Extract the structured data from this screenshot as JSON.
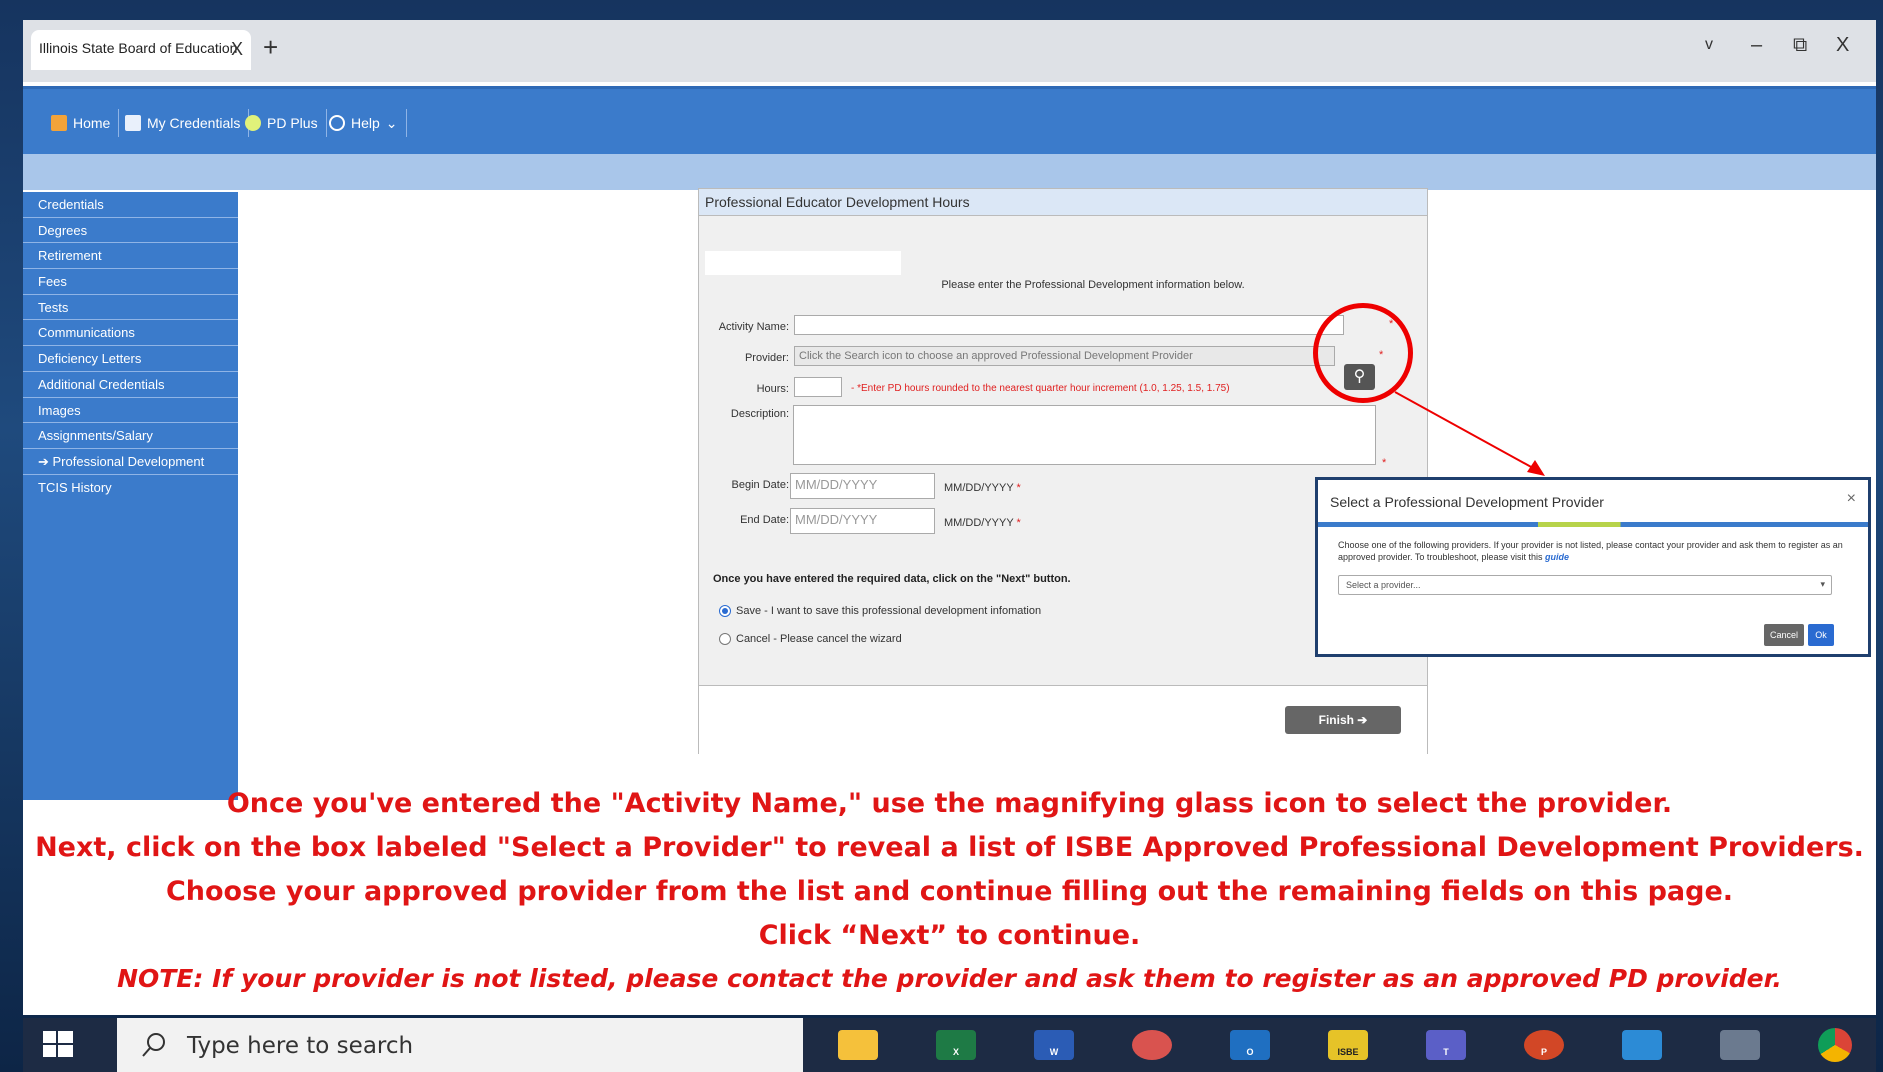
{
  "browser": {
    "tab_title": "Illinois State Board of Education",
    "tab_close": "X",
    "new_tab": "+",
    "controls": {
      "chevron": "v",
      "minimize": "–",
      "restore": "⧉",
      "close": "X"
    }
  },
  "topnav": [
    {
      "label": "Home",
      "icon": "home-icon",
      "color": "#f2a33a"
    },
    {
      "label": "My Credentials",
      "icon": "credentials-icon",
      "color": "#e9f0fb"
    },
    {
      "label": "PD Plus",
      "icon": "sparkle-icon",
      "color": "#e0f27a"
    },
    {
      "label": "Help",
      "icon": "help-icon",
      "color": "#ffffff"
    }
  ],
  "help_chevron": "⌄",
  "sidebar": [
    "Credentials",
    "Degrees",
    "Retirement",
    "Fees",
    "Tests",
    "Communications",
    "Deficiency Letters",
    "Additional Credentials",
    "Images",
    "Assignments/Salary",
    "➔ Professional Development",
    "TCIS History"
  ],
  "form": {
    "title": "Professional Educator Development Hours",
    "intro": "Please enter the Professional Development information below.",
    "activity_label": "Activity Name:",
    "provider_label": "Provider:",
    "provider_placeholder": "Click the Search icon to choose an approved Professional Development Provider",
    "hours_label": "Hours:",
    "hours_hint": "- *Enter PD hours rounded to the nearest quarter hour increment (1.0, 1.25, 1.5, 1.75)",
    "description_label": "Description:",
    "begin_label": "Begin Date:",
    "end_label": "End Date:",
    "date_placeholder": "MM/DD/YYYY",
    "date_format": "MM/DD/YYYY",
    "required": "*",
    "next_text": "Once you have entered the required data, click on the \"Next\" button.",
    "save_option": "Save - I want to save this professional development infomation",
    "cancel_option": "Cancel - Please cancel the wizard",
    "finish_label": "Finish ➔"
  },
  "modal": {
    "title": "Select a Professional Development Provider",
    "close": "×",
    "text": "Choose one of the following providers. If your provider is not listed, please contact your provider and ask them to register as an approved provider. To troubleshoot, please visit this",
    "link": "guide",
    "select_placeholder": "Select a provider...",
    "cancel": "Cancel",
    "ok": "Ok"
  },
  "captions": [
    "Once you've entered the \"Activity Name,\" use the magnifying glass icon to select the provider.",
    "Next, click on the box labeled \"Select a Provider\" to reveal a list of ISBE Approved Professional Development Providers.",
    "Choose your approved provider from the list and continue filling out the remaining fields on this page.",
    "Click “Next” to continue."
  ],
  "note": "NOTE: If your provider is not listed, please contact the provider and ask them to register as an approved PD provider.",
  "taskbar": {
    "search_placeholder": "Type here to search",
    "apps": [
      {
        "name": "file-explorer-icon",
        "color": "#f5c13b",
        "label": ""
      },
      {
        "name": "excel-icon",
        "color": "#1e7a45",
        "label": "X"
      },
      {
        "name": "word-icon",
        "color": "#2b5cb5",
        "label": "W"
      },
      {
        "name": "snipping-tool-icon",
        "color": "#d9534f",
        "label": ""
      },
      {
        "name": "outlook-icon",
        "color": "#1f6fc1",
        "label": "O"
      },
      {
        "name": "isbe-icon",
        "color": "#e6c328",
        "label": "ISBE"
      },
      {
        "name": "teams-icon",
        "color": "#5b5fc7",
        "label": "T"
      },
      {
        "name": "powerpoint-icon",
        "color": "#d24726",
        "label": "P"
      },
      {
        "name": "remote-desktop-icon",
        "color": "#2c8bd6",
        "label": ""
      },
      {
        "name": "calculator-icon",
        "color": "#6b7a8f",
        "label": ""
      },
      {
        "name": "chrome-icon",
        "color": "#e8a42a",
        "label": ""
      }
    ]
  }
}
